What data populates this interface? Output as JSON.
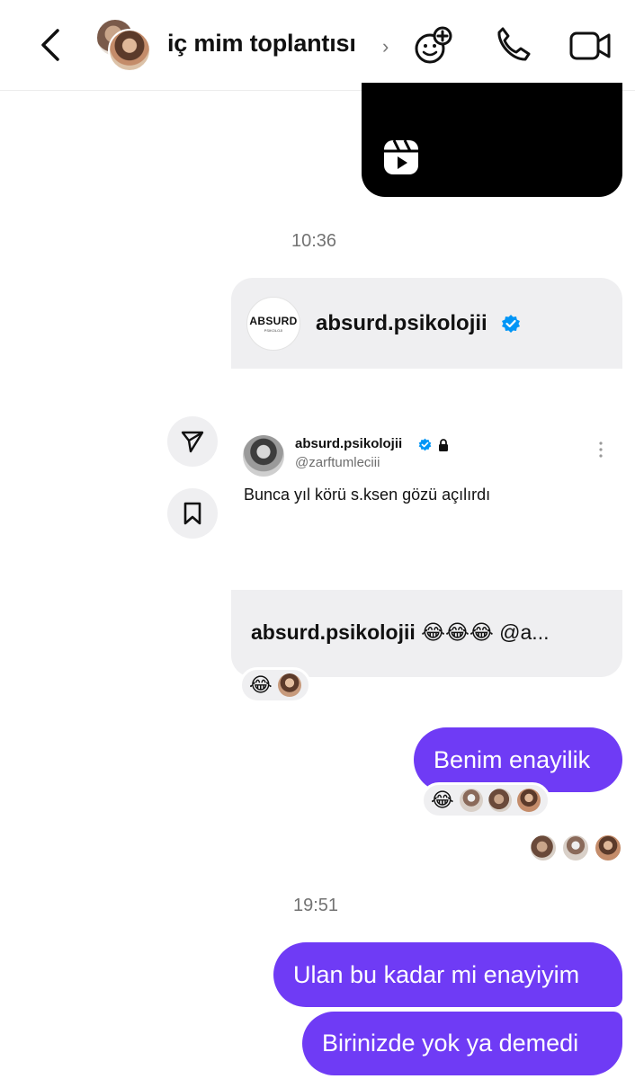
{
  "header": {
    "title": "iç mim toplantısı",
    "chevron": "›",
    "icons": [
      "back-arrow-icon",
      "add-effect-icon",
      "phone-icon",
      "video-camera-icon"
    ]
  },
  "timestamps": [
    "10:36",
    "19:51"
  ],
  "shared_post": {
    "logo_text": "ABSURD",
    "logo_subtext": "PSIKOLOJI",
    "username": "absurd.psikolojii",
    "tweet": {
      "name": "absurd.psikolojii",
      "handle": "@zarftumleciii",
      "text": "Bunca yıl körü s.ksen gözü açılırdı"
    },
    "caption_user": "absurd.psikolojii",
    "caption_rest": "😂😂😂 @a..."
  },
  "reactions": {
    "post": "😂",
    "message1": "😂"
  },
  "messages": [
    "Benim enayilik",
    "Ulan bu kadar mi enayiyim",
    "Birinizde yok ya demedi"
  ],
  "colors": {
    "accent": "#6f3bf5",
    "bubble_grey": "#efeff1",
    "verified": "#0095f6"
  }
}
